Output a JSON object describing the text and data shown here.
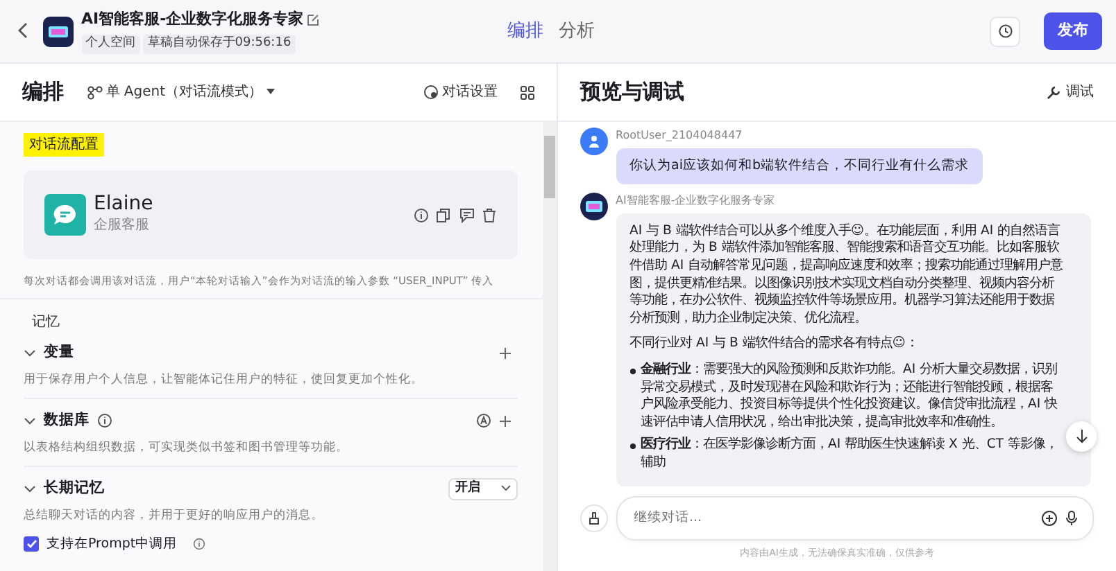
{
  "header": {
    "title": "AI智能客服-企业数字化服务专家",
    "tags": [
      "个人空间",
      "草稿自动保存于09:56:16"
    ],
    "tabs": [
      {
        "label": "编排",
        "selected": true
      },
      {
        "label": "分析",
        "selected": false
      }
    ],
    "publish": "发布"
  },
  "left": {
    "title": "编排",
    "mode": "单 Agent（对话流模式）",
    "settings": "对话设置",
    "section_label": "对话流配置",
    "agent": {
      "name": "Elaine",
      "role": "企服客服"
    },
    "note": "每次对话都会调用该对话流，用户“本轮对话输入”会作为对话流的输入参数 “USER_INPUT” 传入",
    "memory_title": "记忆",
    "groups": [
      {
        "title": "变量",
        "expanded": true,
        "kind": "add",
        "description": "用于保存用户个人信息，让智能体记住用户的特征，使回复更加个性化。"
      },
      {
        "title": "数据库",
        "expanded": true,
        "kind": "database",
        "description": "以表格结构组织数据，可实现类似书签和图书管理等功能。"
      },
      {
        "title": "长期记忆",
        "expanded": true,
        "kind": "select",
        "value": "开启",
        "description": "总结聊天对话的内容，并用于更好的响应用户的消息。",
        "option": {
          "label": "支持在Prompt中调用",
          "checked": true
        }
      }
    ]
  },
  "right": {
    "title": "预览与调试",
    "debug": "调试",
    "messages": [
      {
        "kind": "user",
        "sender": "RootUser_2104048447",
        "text": "你认为ai应该如何和b端软件结合，不同行业有什么需求"
      },
      {
        "kind": "bot",
        "sender": "AI智能客服-企业数字化服务专家",
        "blocks": [
          {
            "kind": "text",
            "text": "AI 与 B 端软件结合可以从多个维度入手☺。在功能层面，利用 AI 的自然语言处理能力，为 B 端软件添加智能客服、智能搜索和语音交互功能。比如客服软件借助 AI 自动解答常见问题，提高响应速度和效率；搜索功能通过理解用户意图，提供更精准结果。以图像识别技术实现文档自动分类整理、视频内容分析等功能，在办公软件、视频监控软件等场景应用。机器学习算法还能用于数据分析预测，助力企业制定决策、优化流程。"
          },
          {
            "kind": "text",
            "text": "不同行业对 AI 与 B 端软件结合的需求各有特点☺："
          },
          {
            "kind": "bullet",
            "text": "**金融行业**：需要强大的风险预测和反欺诈功能。AI 分析大量交易数据，识别异常交易模式，及时发现潜在风险和欺诈行为；还能进行智能投顾，根据客户风险承受能力、投资目标等提供个性化投资建议。像信贷审批流程，AI 快速评估申请人信用状况，给出审批决策，提高审批效率和准确性。"
          },
          {
            "kind": "bullet",
            "text": "**医疗行业**：在医学影像诊断方面，AI 帮助医生快速解读 X 光、CT 等影像，辅助"
          }
        ]
      }
    ],
    "input": {
      "placeholder": "继续对话..."
    },
    "disclaimer": "内容由AI生成，无法确保真实准确，仅供参考"
  }
}
